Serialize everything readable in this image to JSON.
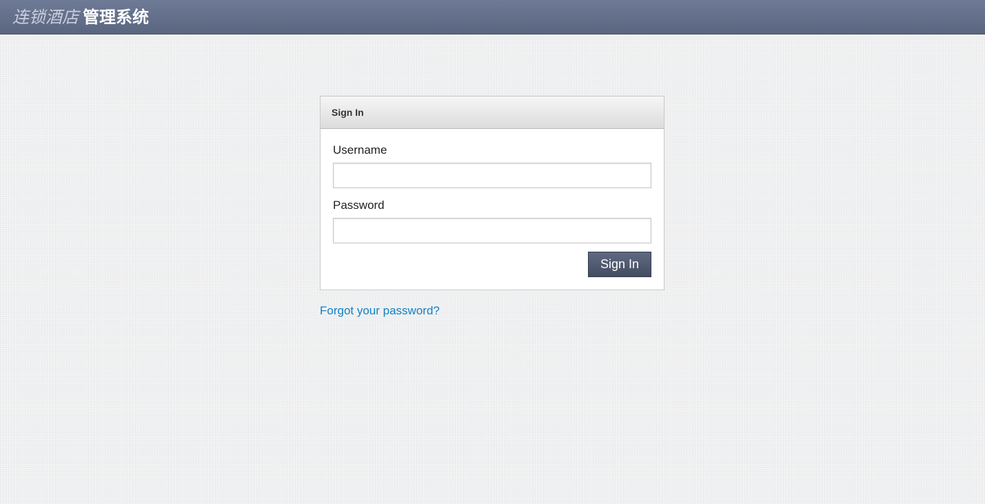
{
  "header": {
    "brand_light": "连锁酒店",
    "brand_bold": "管理系统"
  },
  "login_panel": {
    "title": "Sign In",
    "username_label": "Username",
    "username_value": "",
    "username_placeholder": "",
    "password_label": "Password",
    "password_value": "",
    "password_placeholder": "",
    "submit_label": "Sign In"
  },
  "forgot_link": "Forgot your password?",
  "colors": {
    "header_bar": "#5f6a85",
    "button": "#4f586e",
    "link": "#1380c3"
  }
}
